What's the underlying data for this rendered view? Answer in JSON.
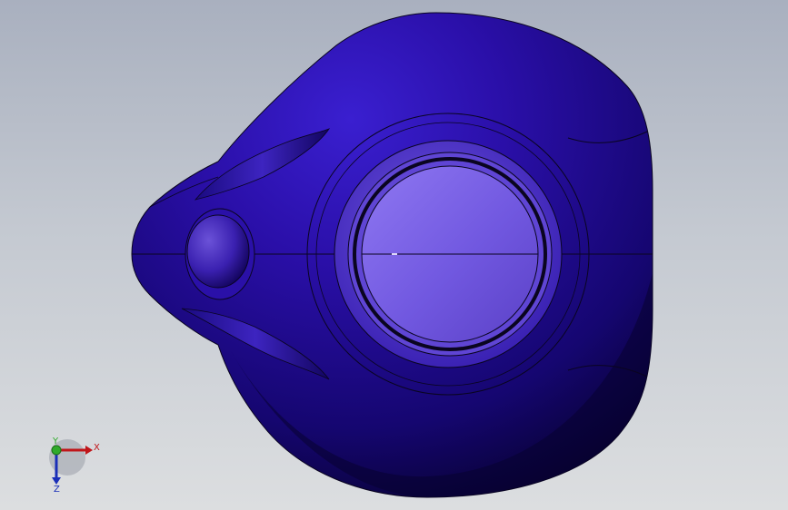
{
  "viewport": {
    "model_color": "#2a0fa8",
    "model_dark": "#08023a",
    "face_color": "#7a62e6",
    "edge_color": "#0a0520"
  },
  "triad": {
    "x_label": "X",
    "y_label": "Y",
    "z_label": "Z",
    "x_color": "#c0161a",
    "y_color": "#2faa2a",
    "z_color": "#1a2fb8"
  }
}
